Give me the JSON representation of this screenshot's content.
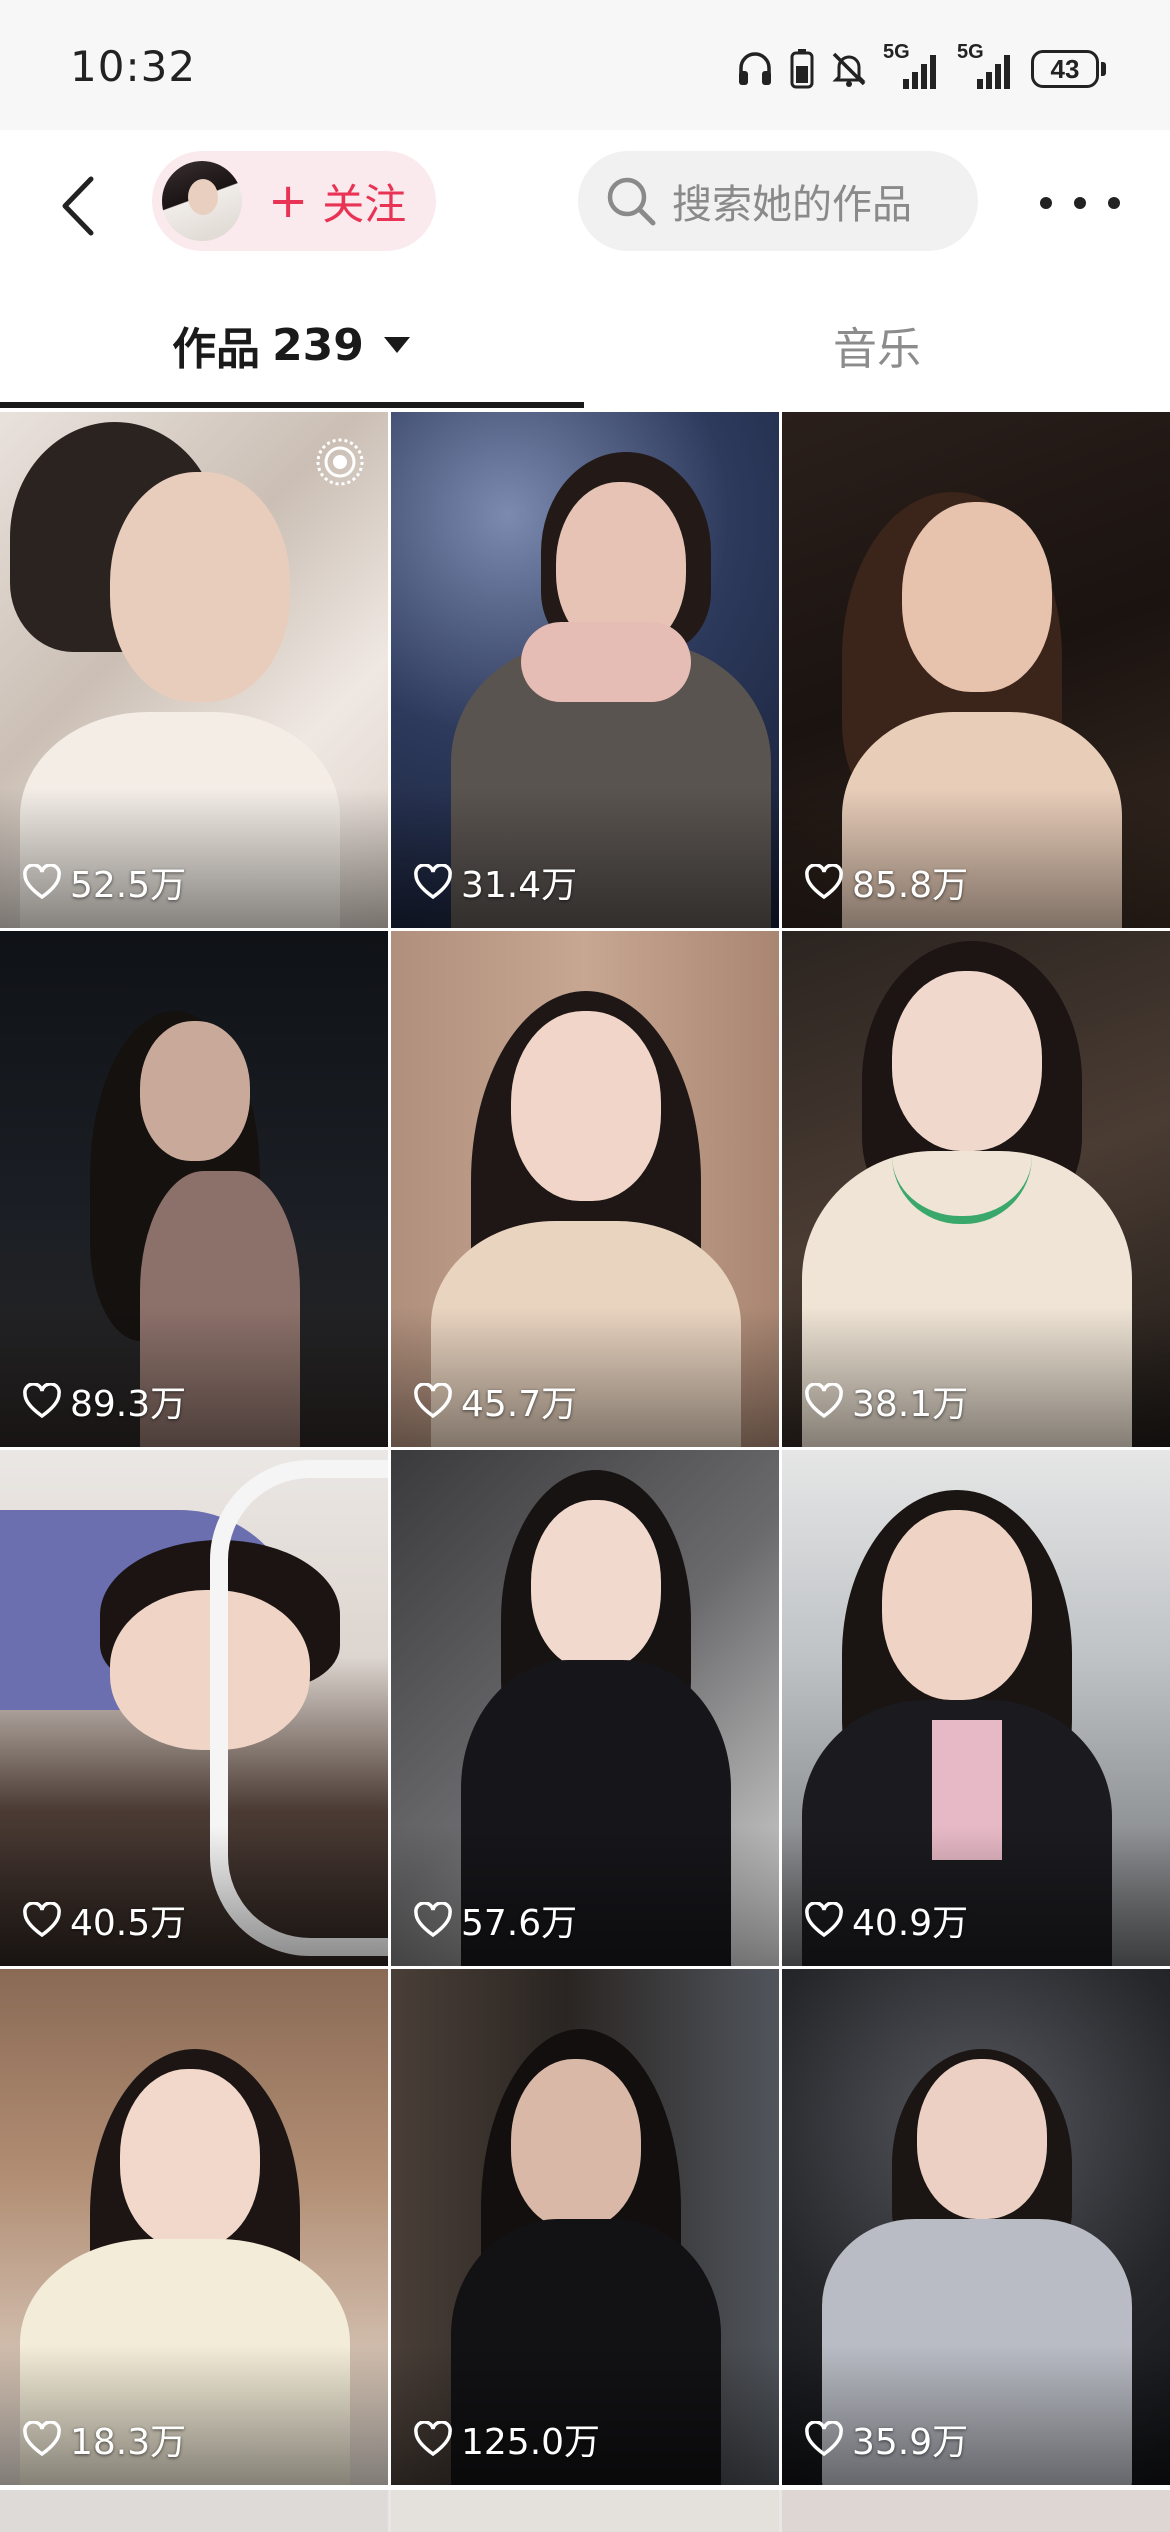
{
  "status_bar": {
    "time": "10:32",
    "network_1": "5G",
    "network_2": "5G",
    "battery": "43",
    "icons": [
      "headphones-icon",
      "battery-saver-icon",
      "mute-icon",
      "signal-icon",
      "signal-icon",
      "battery-icon"
    ]
  },
  "header": {
    "follow_label": "关注",
    "follow_plus": "+",
    "search_placeholder": "搜索她的作品",
    "icons": [
      "back-arrow-icon",
      "avatar",
      "search-icon",
      "more-icon"
    ]
  },
  "tabs": [
    {
      "label": "作品",
      "count": "239",
      "active": true
    },
    {
      "label": "音乐",
      "active": false
    }
  ],
  "grid": {
    "items": [
      {
        "likes": "52.5万",
        "live": true
      },
      {
        "likes": "31.4万"
      },
      {
        "likes": "85.8万"
      },
      {
        "likes": "89.3万"
      },
      {
        "likes": "45.7万"
      },
      {
        "likes": "38.1万"
      },
      {
        "likes": "40.5万"
      },
      {
        "likes": "57.6万"
      },
      {
        "likes": "40.9万"
      },
      {
        "likes": "18.3万"
      },
      {
        "likes": "125.0万"
      },
      {
        "likes": "35.9万"
      }
    ]
  },
  "colors": {
    "accent": "#e83355",
    "follow_bg": "#fbeaed",
    "search_bg": "#f1f1f1"
  }
}
